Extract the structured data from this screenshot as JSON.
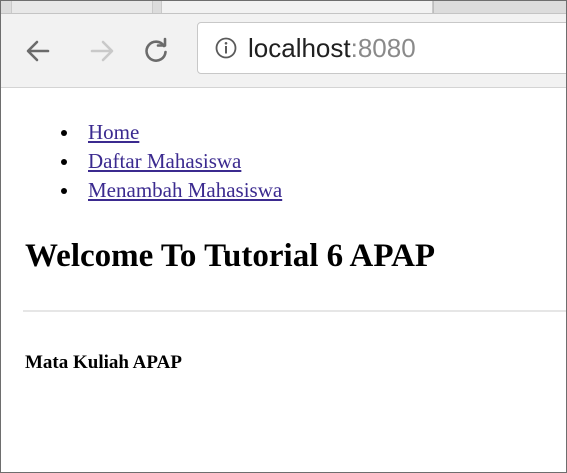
{
  "browser": {
    "address_host": "localhost",
    "address_port": ":8080",
    "icons": {
      "back": "arrow-left-icon",
      "forward": "arrow-right-icon",
      "reload": "reload-icon",
      "info": "info-icon"
    }
  },
  "page": {
    "nav_links": [
      {
        "label": "Home"
      },
      {
        "label": "Daftar Mahasiswa"
      },
      {
        "label": "Menambah Mahasiswa"
      }
    ],
    "title": "Welcome To Tutorial 6 APAP",
    "section_title": "Mata Kuliah APAP"
  },
  "colors": {
    "link": "#3b2a8f",
    "toolbar_bg": "#f2f2f2"
  }
}
